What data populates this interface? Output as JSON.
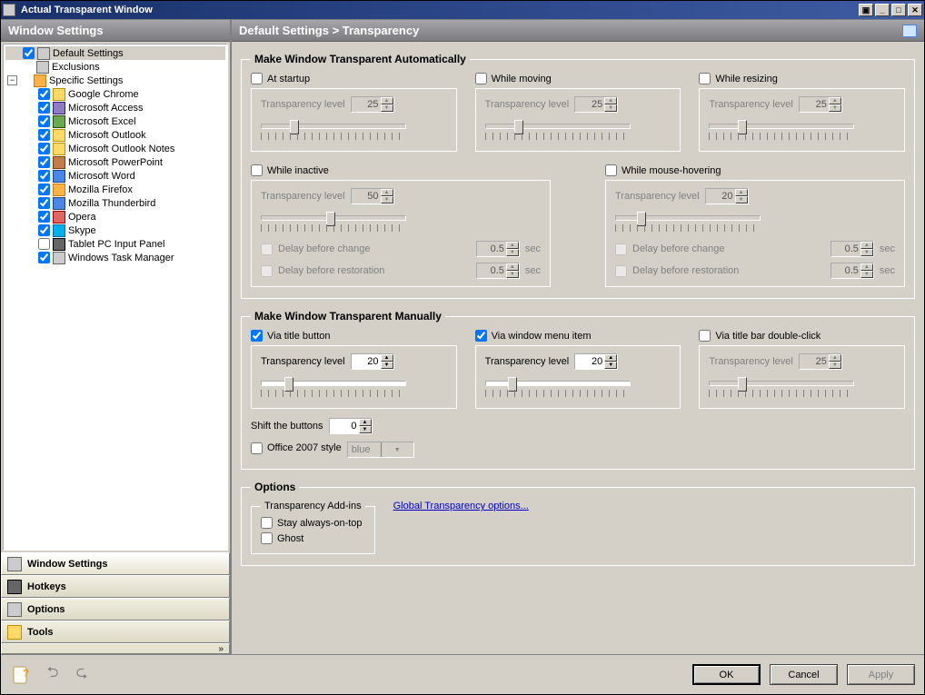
{
  "window": {
    "title": "Actual Transparent Window"
  },
  "sidebar": {
    "header": "Window Settings",
    "tree": {
      "default": "Default Settings",
      "exclusions": "Exclusions",
      "specific": "Specific Settings",
      "items": [
        {
          "label": "Google Chrome",
          "checked": true
        },
        {
          "label": "Microsoft Access",
          "checked": true
        },
        {
          "label": "Microsoft Excel",
          "checked": true
        },
        {
          "label": "Microsoft Outlook",
          "checked": true
        },
        {
          "label": "Microsoft Outlook Notes",
          "checked": true
        },
        {
          "label": "Microsoft PowerPoint",
          "checked": true
        },
        {
          "label": "Microsoft Word",
          "checked": true
        },
        {
          "label": "Mozilla Firefox",
          "checked": true
        },
        {
          "label": "Mozilla Thunderbird",
          "checked": true
        },
        {
          "label": "Opera",
          "checked": true
        },
        {
          "label": "Skype",
          "checked": true
        },
        {
          "label": "Tablet PC Input Panel",
          "checked": false
        },
        {
          "label": "Windows Task Manager",
          "checked": true
        }
      ]
    },
    "nav": {
      "window": "Window Settings",
      "hotkeys": "Hotkeys",
      "options": "Options",
      "tools": "Tools"
    }
  },
  "breadcrumb": "Default Settings > Transparency",
  "auto": {
    "legend": "Make Window Transparent Automatically",
    "startup": {
      "label": "At startup",
      "level_label": "Transparency level",
      "level": "25"
    },
    "moving": {
      "label": "While moving",
      "level_label": "Transparency level",
      "level": "25"
    },
    "resizing": {
      "label": "While resizing",
      "level_label": "Transparency level",
      "level": "25"
    },
    "inactive": {
      "label": "While inactive",
      "level_label": "Transparency level",
      "level": "50",
      "delay_change": "Delay before change",
      "delay_change_val": "0.5",
      "delay_restore": "Delay before restoration",
      "delay_restore_val": "0.5",
      "sec": "sec"
    },
    "hover": {
      "label": "While mouse-hovering",
      "level_label": "Transparency level",
      "level": "20",
      "delay_change": "Delay before change",
      "delay_change_val": "0.5",
      "delay_restore": "Delay before restoration",
      "delay_restore_val": "0.5",
      "sec": "sec"
    }
  },
  "manual": {
    "legend": "Make Window Transparent Manually",
    "title_btn": {
      "label": "Via title button",
      "level_label": "Transparency level",
      "level": "20"
    },
    "menu_item": {
      "label": "Via window menu item",
      "level_label": "Transparency level",
      "level": "20"
    },
    "dbl_click": {
      "label": "Via title bar double-click",
      "level_label": "Transparency level",
      "level": "25"
    },
    "shift_label": "Shift the buttons",
    "shift_val": "0",
    "office_label": "Office 2007 style",
    "office_sel": "blue"
  },
  "options": {
    "legend": "Options",
    "addins_legend": "Transparency Add-ins",
    "stay": "Stay always-on-top",
    "ghost": "Ghost",
    "link": "Global Transparency options..."
  },
  "buttons": {
    "ok": "OK",
    "cancel": "Cancel",
    "apply": "Apply"
  }
}
